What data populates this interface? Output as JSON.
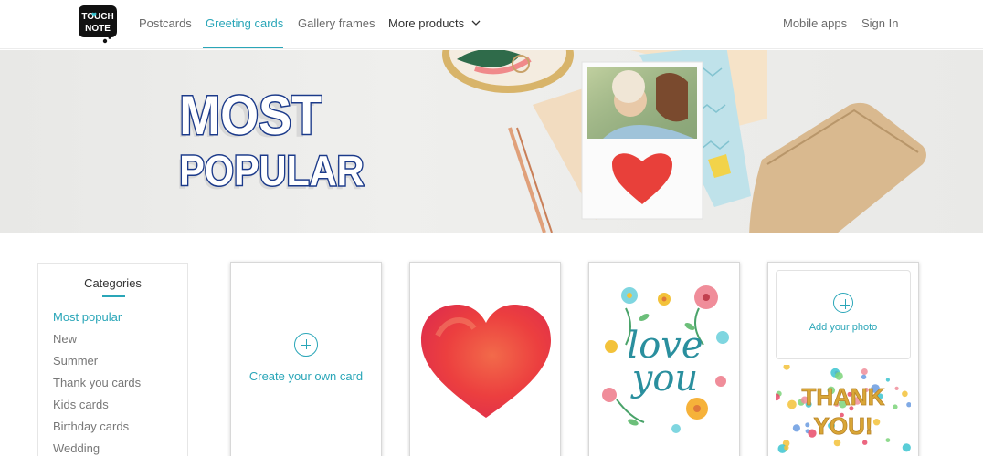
{
  "header": {
    "logo_text": [
      "TOUCH",
      "NOTE"
    ],
    "nav": {
      "postcards": "Postcards",
      "greeting_cards": "Greeting cards",
      "gallery_frames": "Gallery frames",
      "more_products": "More products"
    },
    "right": {
      "mobile_apps": "Mobile apps",
      "sign_in": "Sign In"
    }
  },
  "banner": {
    "headline_line1": "MOST",
    "headline_line2": "POPULAR"
  },
  "sidebar": {
    "title": "Categories",
    "items": [
      {
        "label": "Most popular",
        "active": true
      },
      {
        "label": "New",
        "active": false
      },
      {
        "label": "Summer",
        "active": false
      },
      {
        "label": "Thank you cards",
        "active": false
      },
      {
        "label": "Kids cards",
        "active": false
      },
      {
        "label": "Birthday cards",
        "active": false
      },
      {
        "label": "Wedding",
        "active": false
      }
    ]
  },
  "cards": {
    "create": {
      "label": "Create your own card"
    },
    "heart": {},
    "love_you": {
      "text_line1": "love",
      "text_line2": "you"
    },
    "thank_you": {
      "add_photo_label": "Add your photo",
      "text_line1": "THANK",
      "text_line2": "YOU!"
    }
  },
  "colors": {
    "accent": "#2aa6b8",
    "logo_bg": "#111111",
    "logo_heart": "#3cc4d0",
    "headline": "#1b3a8a"
  },
  "icons": {
    "chevron": "chevron-down-icon",
    "plus": "plus-circle-icon"
  }
}
